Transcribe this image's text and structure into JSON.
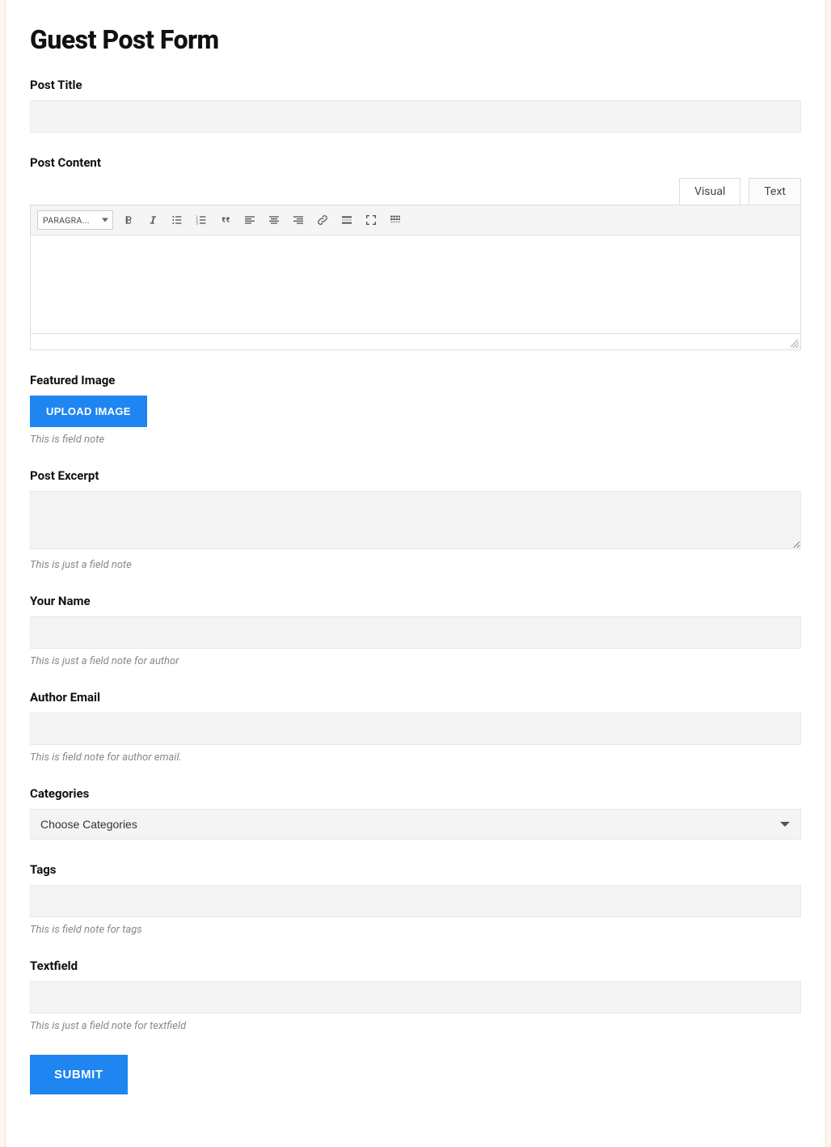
{
  "page": {
    "title": "Guest Post Form"
  },
  "fields": {
    "post_title": {
      "label": "Post Title",
      "value": ""
    },
    "post_content": {
      "label": "Post Content",
      "tabs": {
        "visual": "Visual",
        "text": "Text"
      },
      "format_dropdown": "PARAGRA...",
      "toolbar": {
        "bold": "bold-icon",
        "italic": "italic-icon",
        "ul": "bullet-list-icon",
        "ol": "numbered-list-icon",
        "quote": "blockquote-icon",
        "align_left": "align-left-icon",
        "align_center": "align-center-icon",
        "align_right": "align-right-icon",
        "link": "link-icon",
        "readmore": "read-more-icon",
        "fullscreen": "fullscreen-icon",
        "toolbar_toggle": "toolbar-toggle-icon"
      },
      "value": ""
    },
    "featured_image": {
      "label": "Featured Image",
      "button": "UPLOAD IMAGE",
      "note": "This is field note"
    },
    "post_excerpt": {
      "label": "Post Excerpt",
      "value": "",
      "note": "This is just a field note"
    },
    "your_name": {
      "label": "Your Name",
      "value": "",
      "note": "This is just a field note for author"
    },
    "author_email": {
      "label": "Author Email",
      "value": "",
      "note": "This is field note for author email."
    },
    "categories": {
      "label": "Categories",
      "selected": "Choose Categories"
    },
    "tags": {
      "label": "Tags",
      "value": "",
      "note": "This is field note for tags"
    },
    "textfield": {
      "label": "Textfield",
      "value": "",
      "note": "This is just a field note for textfield"
    }
  },
  "actions": {
    "submit": "SUBMIT"
  },
  "colors": {
    "primary": "#1e85f1",
    "page_bg": "#fff6ed",
    "input_bg": "#f4f4f4"
  }
}
